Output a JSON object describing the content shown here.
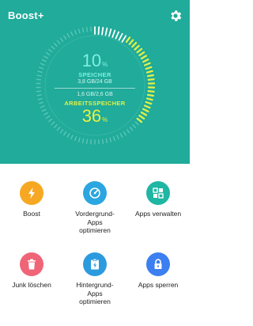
{
  "app": {
    "title": "Boost+"
  },
  "colors": {
    "header_bg": "#20ab9a",
    "gauge_active": "#e6f244",
    "gauge_inactive": "#5cc5b8",
    "storage_text": "#7ef0e0",
    "ram_text": "#e6f244",
    "boost": "#f7a823",
    "vordergrund": "#2ba6e0",
    "apps_verwalten": "#1fb6a3",
    "junk": "#f06478",
    "hintergrund": "#2b9bde",
    "apps_sperren": "#3c7ff0"
  },
  "gauge": {
    "storage_value": "10",
    "storage_unit": "%",
    "storage_label": "SPEICHER",
    "storage_detail": "3,8 GB/24 GB",
    "ram_detail": "1,6 GB/2,6 GB",
    "ram_label": "ARBEITSSPEICHER",
    "ram_value": "36",
    "ram_unit": "%",
    "ram_fraction": 0.36,
    "storage_fraction": 0.1
  },
  "tiles": [
    {
      "label": "Boost",
      "icon": "lightning-icon"
    },
    {
      "label": "Vordergrund-\nApps\noptimieren",
      "icon": "speedometer-icon"
    },
    {
      "label": "Apps verwalten",
      "icon": "apps-grid-icon"
    },
    {
      "label": "Junk löschen",
      "icon": "trash-icon"
    },
    {
      "label": "Hintergrund-\nApps\noptimieren",
      "icon": "clipboard-bolt-icon"
    },
    {
      "label": "Apps sperren",
      "icon": "lock-icon"
    }
  ]
}
